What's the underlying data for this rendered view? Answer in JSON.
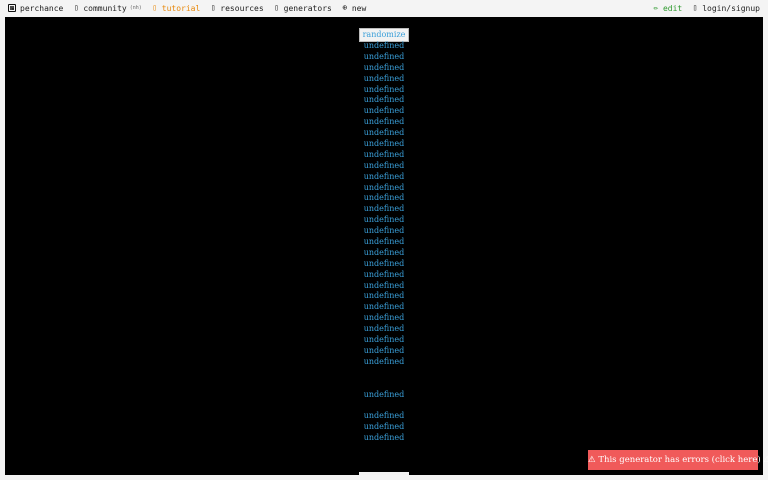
{
  "nav": {
    "left": [
      {
        "name": "perchance",
        "label": "perchance",
        "icon": "die-icon"
      },
      {
        "name": "community",
        "label": "community",
        "tag": "(nh)",
        "icon": "chat-icon"
      },
      {
        "name": "tutorial",
        "label": "tutorial",
        "icon": "book-icon",
        "color": "#e8890c"
      },
      {
        "name": "resources",
        "label": "resources",
        "icon": "box-icon"
      },
      {
        "name": "generators",
        "label": "generators",
        "icon": "list-icon"
      },
      {
        "name": "new",
        "label": "new",
        "icon": "plus-circle-icon"
      }
    ],
    "right": [
      {
        "name": "edit",
        "label": "edit",
        "icon": "pencil-icon",
        "color": "#2e9a2e"
      },
      {
        "name": "login",
        "label": "login/signup",
        "icon": "user-icon"
      }
    ]
  },
  "main": {
    "randomize_label": "randomize",
    "output_lines": [
      "undefined",
      "undefined",
      "undefined",
      "undefined",
      "undefined",
      "undefined",
      "undefined",
      "undefined",
      "undefined",
      "undefined",
      "undefined",
      "undefined",
      "undefined",
      "undefined",
      "undefined",
      "undefined",
      "undefined",
      "undefined",
      "undefined",
      "undefined",
      "undefined",
      "undefined",
      "undefined",
      "undefined",
      "undefined",
      "undefined",
      "undefined",
      "undefined",
      "undefined",
      "undefined",
      "",
      "",
      "undefined",
      "",
      "undefined",
      "undefined",
      "undefined"
    ],
    "error_label": "⚠ This generator has errors (click here) ⚠"
  },
  "colors": {
    "background": "#000000",
    "link": "#3a9fd9",
    "error": "#f05a5a",
    "topbar": "#f4f4f4"
  }
}
